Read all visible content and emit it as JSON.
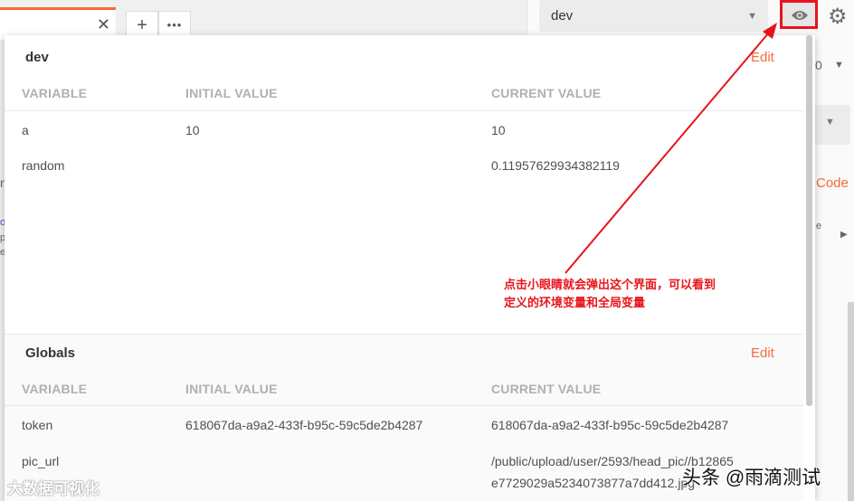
{
  "header": {
    "tab_close": "✕",
    "add_tab": "+",
    "more_tabs": "•••",
    "env_selected": "dev",
    "env_caret": "▼",
    "gear": "⚙"
  },
  "background": {
    "snip_1": "0",
    "snip_2": "▼",
    "code_link": "Code",
    "snip_e": "e",
    "snip_arrow": "▶",
    "snip_n": "n",
    "snip_o": "o",
    "snip_p": "p",
    "snip_e2": "e"
  },
  "popup": {
    "env": {
      "title": "dev",
      "edit_label": "Edit",
      "columns": [
        "VARIABLE",
        "INITIAL VALUE",
        "CURRENT VALUE"
      ],
      "rows": [
        {
          "variable": "a",
          "initial": "10",
          "current": "10"
        },
        {
          "variable": "random",
          "initial": "",
          "current": "0.11957629934382119"
        }
      ]
    },
    "globals": {
      "title": "Globals",
      "edit_label": "Edit",
      "columns": [
        "VARIABLE",
        "INITIAL VALUE",
        "CURRENT VALUE"
      ],
      "rows": [
        {
          "variable": "token",
          "initial": "618067da-a9a2-433f-b95c-59c5de2b4287",
          "current": "618067da-a9a2-433f-b95c-59c5de2b4287"
        },
        {
          "variable": "pic_url",
          "initial": "",
          "current": "/public/upload/user/2593/head_pic//b12865",
          "current_line2": "e7729029a5234073877a7dd412.jpg"
        }
      ]
    }
  },
  "annotation": {
    "line1": "点击小眼睛就会弹出这个界面，可以看到",
    "line2": "定义的环境变量和全局变量",
    "color": "#e8141b"
  },
  "watermarks": {
    "left": "大数据可视化",
    "right": "头条 @雨滴测试"
  },
  "colors": {
    "accent": "#f26b3a",
    "highlight": "#e8141b"
  }
}
